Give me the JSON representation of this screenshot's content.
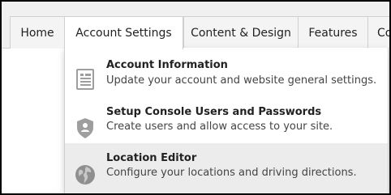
{
  "nav": {
    "items": [
      {
        "label": "Home"
      },
      {
        "label": "Account Settings"
      },
      {
        "label": "Content & Design"
      },
      {
        "label": "Features"
      },
      {
        "label": "Com"
      }
    ],
    "active": "Account Settings"
  },
  "dropdown": {
    "items": [
      {
        "title": "Account Information",
        "description": "Update your account and website general settings.",
        "icon": "document-list-icon"
      },
      {
        "title": "Setup Console Users and Passwords",
        "description": "Create users and allow access to your site.",
        "icon": "shield-user-icon"
      },
      {
        "title": "Location Editor",
        "description": "Configure your locations and driving directions.",
        "icon": "globe-icon"
      }
    ],
    "hovered": "Location Editor"
  },
  "colors": {
    "navbar_bg": "#f0f0f0",
    "hover_bg": "#ececec",
    "icon_gray": "#9e9e9e",
    "frame_border": "#000000"
  }
}
